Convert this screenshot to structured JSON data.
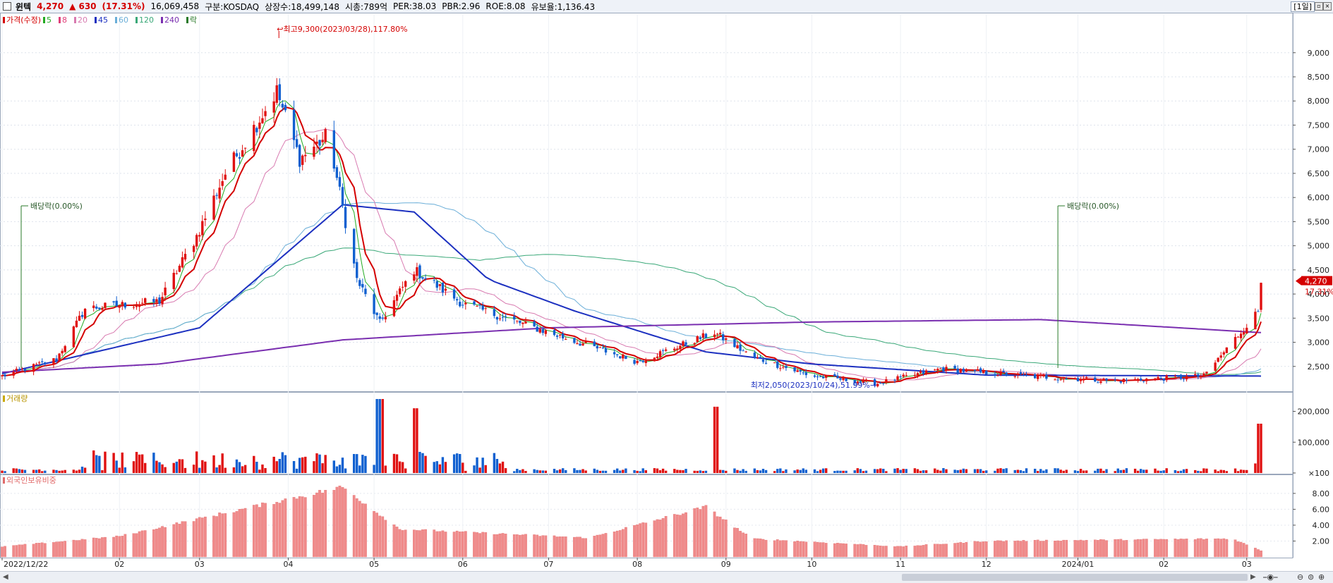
{
  "header": {
    "name": "윈텍",
    "price": "4,270",
    "change": "▲ 630",
    "change_pct": "(17.31%)",
    "volume": "16,069,458",
    "market": "구분:KOSDAQ",
    "shares": "상장수:18,499,148",
    "mcap": "시총:789억",
    "per": "PER:38.03",
    "pbr": "PBR:2.96",
    "roe": "ROE:8.08",
    "float": "유보율:1,136.43",
    "period": "[1일]"
  },
  "legends": {
    "price": [
      {
        "label": "가격(수정)",
        "color": "#d40000"
      },
      {
        "label": "5",
        "color": "#22aa22"
      },
      {
        "label": "8",
        "color": "#e0407a"
      },
      {
        "label": "20",
        "color": "#d87ab0"
      },
      {
        "label": "45",
        "color": "#1c30c0"
      },
      {
        "label": "60",
        "color": "#6aaed8"
      },
      {
        "label": "120",
        "color": "#3aa878"
      },
      {
        "label": "240",
        "color": "#7a2fb0"
      },
      {
        "label": "락",
        "color": "#2a7a2a"
      }
    ],
    "volume": "거래량",
    "foreign": "외국인보유비중"
  },
  "annotations": {
    "high": "최고9,300(2023/03/28),117.80%",
    "low": "최저2,050(2023/10/24),51.99%",
    "div1": "배당락(0.00%)",
    "div2": "배당락(0.00%)",
    "last_price": "4,270",
    "last_pct": "17.31%"
  },
  "chart_data": {
    "type": "candlestick",
    "price_axis": {
      "ticks": [
        2500,
        3000,
        3500,
        4000,
        4500,
        5000,
        5500,
        6000,
        6500,
        7000,
        7500,
        8000,
        8500,
        9000
      ],
      "tick_labels": [
        "2,500",
        "3,000",
        "3,500",
        "4,000",
        "4,500",
        "5,000",
        "5,500",
        "6,000",
        "6,500",
        "7,000",
        "7,500",
        "8,000",
        "8,500",
        "9,000"
      ],
      "ylim": [
        2000,
        9800
      ]
    },
    "volume_axis": {
      "ticks": [
        100,
        100000,
        200000
      ],
      "tick_labels": [
        "×100",
        "100,000",
        "200,000"
      ],
      "ylim": [
        0,
        240000
      ]
    },
    "foreign_axis": {
      "ticks": [
        2,
        4,
        6,
        8
      ],
      "tick_labels": [
        "2.00",
        "4.00",
        "6.00",
        "8.00"
      ],
      "ylim": [
        0,
        9.5
      ]
    },
    "x_labels": [
      "2022/12/22",
      "02",
      "03",
      "04",
      "05",
      "06",
      "07",
      "08",
      "09",
      "10",
      "11",
      "12",
      "2024/01",
      "02",
      "03"
    ],
    "close_points": [
      [
        "2022/12/22",
        2300
      ],
      [
        "2023/01/10",
        2650
      ],
      [
        "2023/01/20",
        3700
      ],
      [
        "2023/02/15",
        3850
      ],
      [
        "2023/02/28",
        5200
      ],
      [
        "2023/03/10",
        6500
      ],
      [
        "2023/03/28",
        8200
      ],
      [
        "2023/04/05",
        6800
      ],
      [
        "2023/04/15",
        7300
      ],
      [
        "2023/04/25",
        4300
      ],
      [
        "2023/05/03",
        3400
      ],
      [
        "2023/05/15",
        4500
      ],
      [
        "2023/06/01",
        3800
      ],
      [
        "2023/07/01",
        3200
      ],
      [
        "2023/08/01",
        2600
      ],
      [
        "2023/08/28",
        3200
      ],
      [
        "2023/09/10",
        2700
      ],
      [
        "2023/10/01",
        2300
      ],
      [
        "2023/10/24",
        2150
      ],
      [
        "2023/11/15",
        2450
      ],
      [
        "2023/12/15",
        2300
      ],
      [
        "2024/01/15",
        2200
      ],
      [
        "2024/02/15",
        2300
      ],
      [
        "2024/03/05",
        3640
      ],
      [
        "2024/03/06",
        4270
      ]
    ],
    "ma45_points": [
      [
        "2022/12/22",
        2350
      ],
      [
        "2023/03/01",
        3300
      ],
      [
        "2023/04/20",
        5850
      ],
      [
        "2023/05/15",
        5700
      ],
      [
        "2023/06/10",
        4300
      ],
      [
        "2023/07/10",
        3650
      ],
      [
        "2023/08/25",
        2800
      ],
      [
        "2023/10/01",
        2550
      ],
      [
        "2023/12/01",
        2320
      ],
      [
        "2024/03/06",
        2300
      ]
    ],
    "ma240_points": [
      [
        "2022/12/22",
        2380
      ],
      [
        "2023/02/15",
        2550
      ],
      [
        "2023/04/20",
        3050
      ],
      [
        "2023/07/01",
        3300
      ],
      [
        "2023/10/01",
        3420
      ],
      [
        "2023/12/20",
        3470
      ],
      [
        "2024/03/06",
        3200
      ]
    ],
    "volume_spikes": [
      [
        "2023/05/03",
        240000
      ],
      [
        "2023/05/15",
        210000
      ],
      [
        "2023/08/28",
        215000
      ],
      [
        "2024/03/06",
        160000
      ]
    ],
    "foreign_points": [
      [
        "2022/12/22",
        1.3
      ],
      [
        "2023/02/01",
        2.6
      ],
      [
        "2023/04/20",
        8.8
      ],
      [
        "2023/05/10",
        3.5
      ],
      [
        "2023/07/15",
        2.4
      ],
      [
        "2023/08/25",
        6.3
      ],
      [
        "2023/09/10",
        2.3
      ],
      [
        "2023/11/01",
        1.3
      ],
      [
        "2023/12/01",
        2.0
      ],
      [
        "2024/02/25",
        2.3
      ],
      [
        "2024/03/06",
        0.8
      ]
    ]
  }
}
